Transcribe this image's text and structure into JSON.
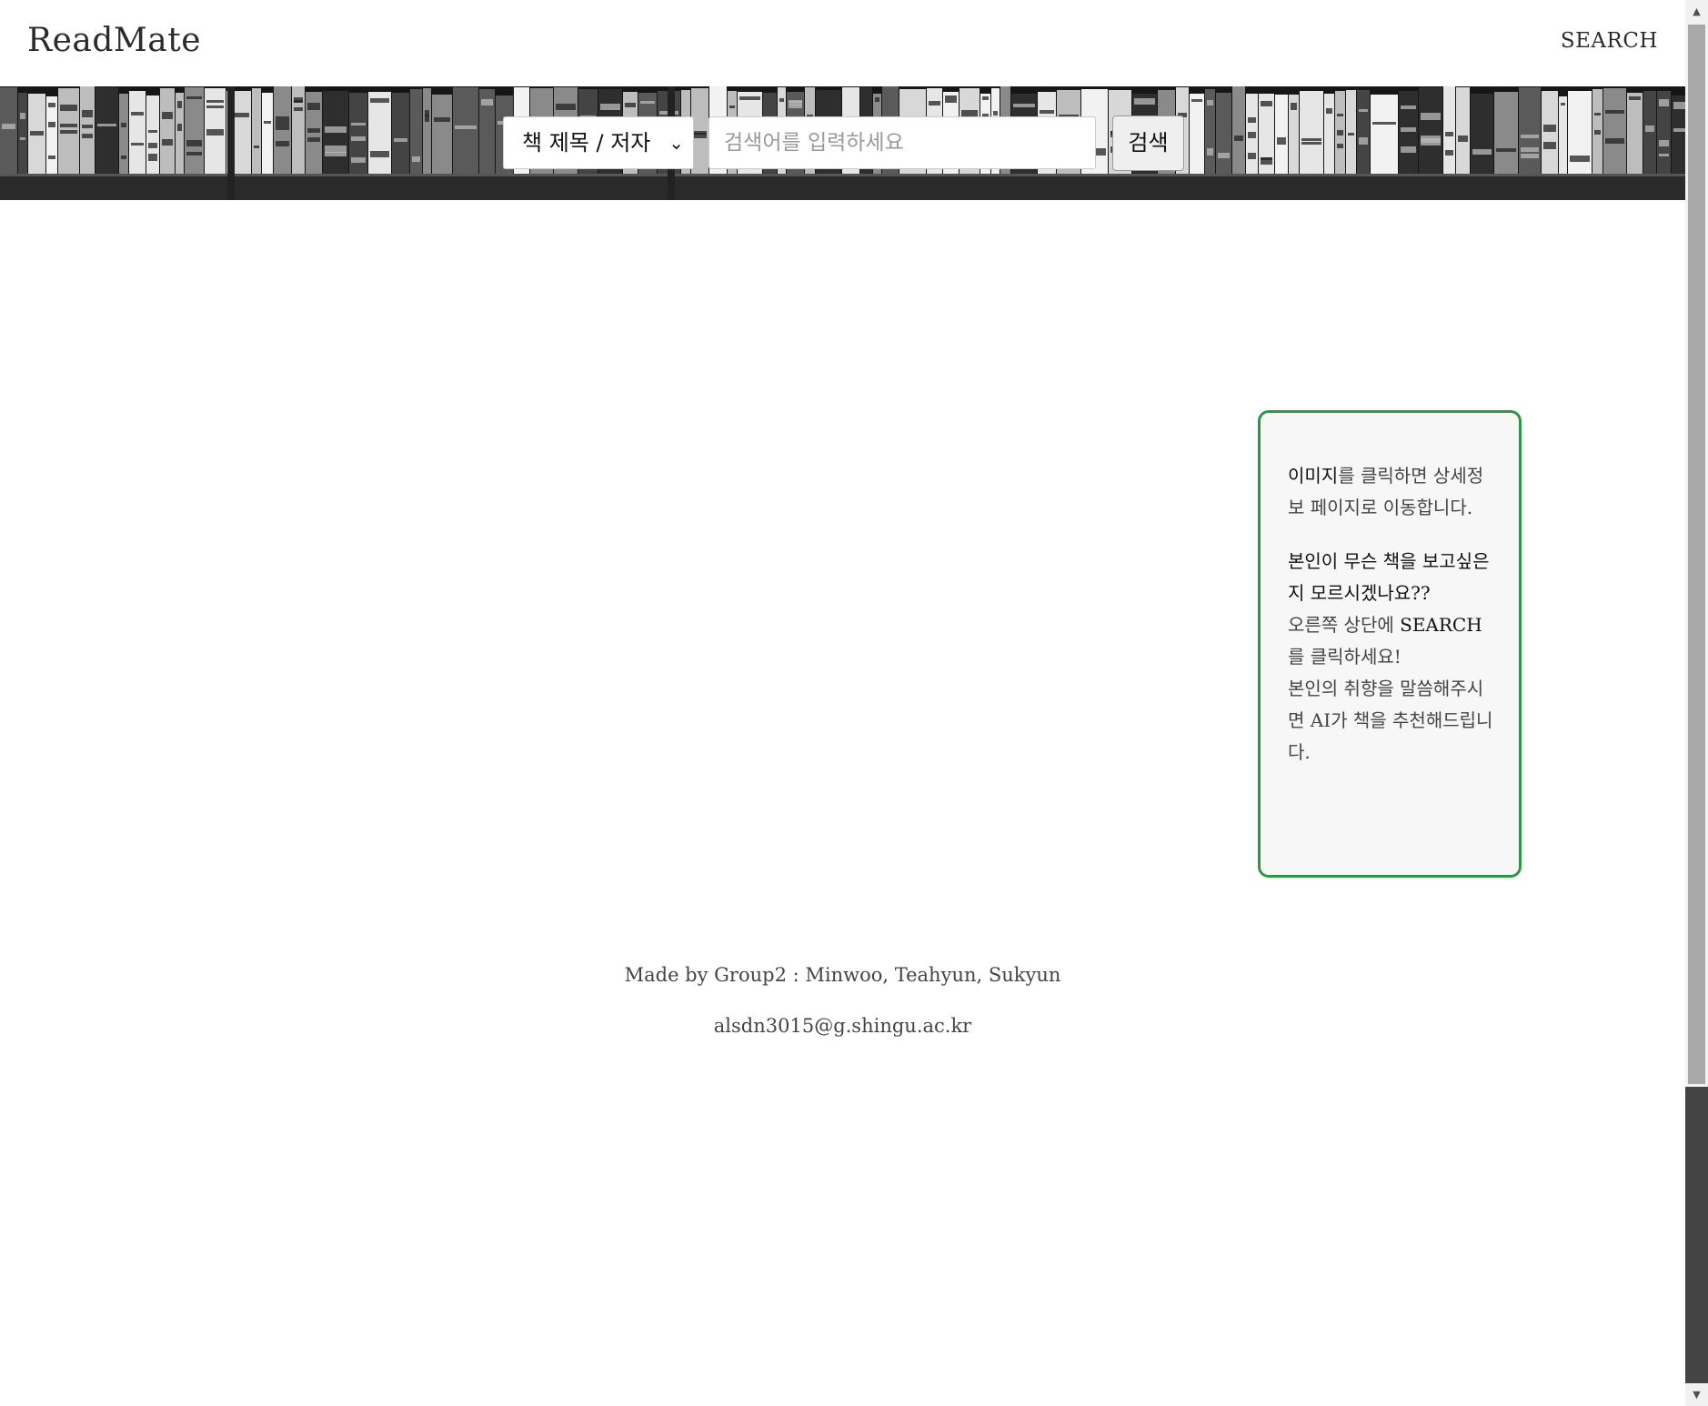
{
  "navbar": {
    "brand": "ReadMate",
    "search_link": "SEARCH"
  },
  "search": {
    "select_value": "책 제목 / 저자",
    "placeholder": "검색어를 입력하세요",
    "button_label": "검색"
  },
  "info_card": {
    "line1_strong": "이미지",
    "line1_rest": "를 클릭하면 상세정보 페이지로 이동합니다.",
    "question": "본인이 무슨 책을 보고싶은지 모르시겠나요??",
    "instruction_prefix": "오른쪽 상단에 ",
    "instruction_strong": "SEARCH",
    "instruction_suffix": "를 클릭하세요!",
    "ai_text": "본인의 취향을 말씀해주시면 AI가 책을 추천해드립니다.",
    "border_color": "#2e9645"
  },
  "footer": {
    "credit": "Made by Group2 : Minwoo, Teahyun, Sukyun",
    "email": "alsdn3015@g.shingu.ac.kr"
  }
}
